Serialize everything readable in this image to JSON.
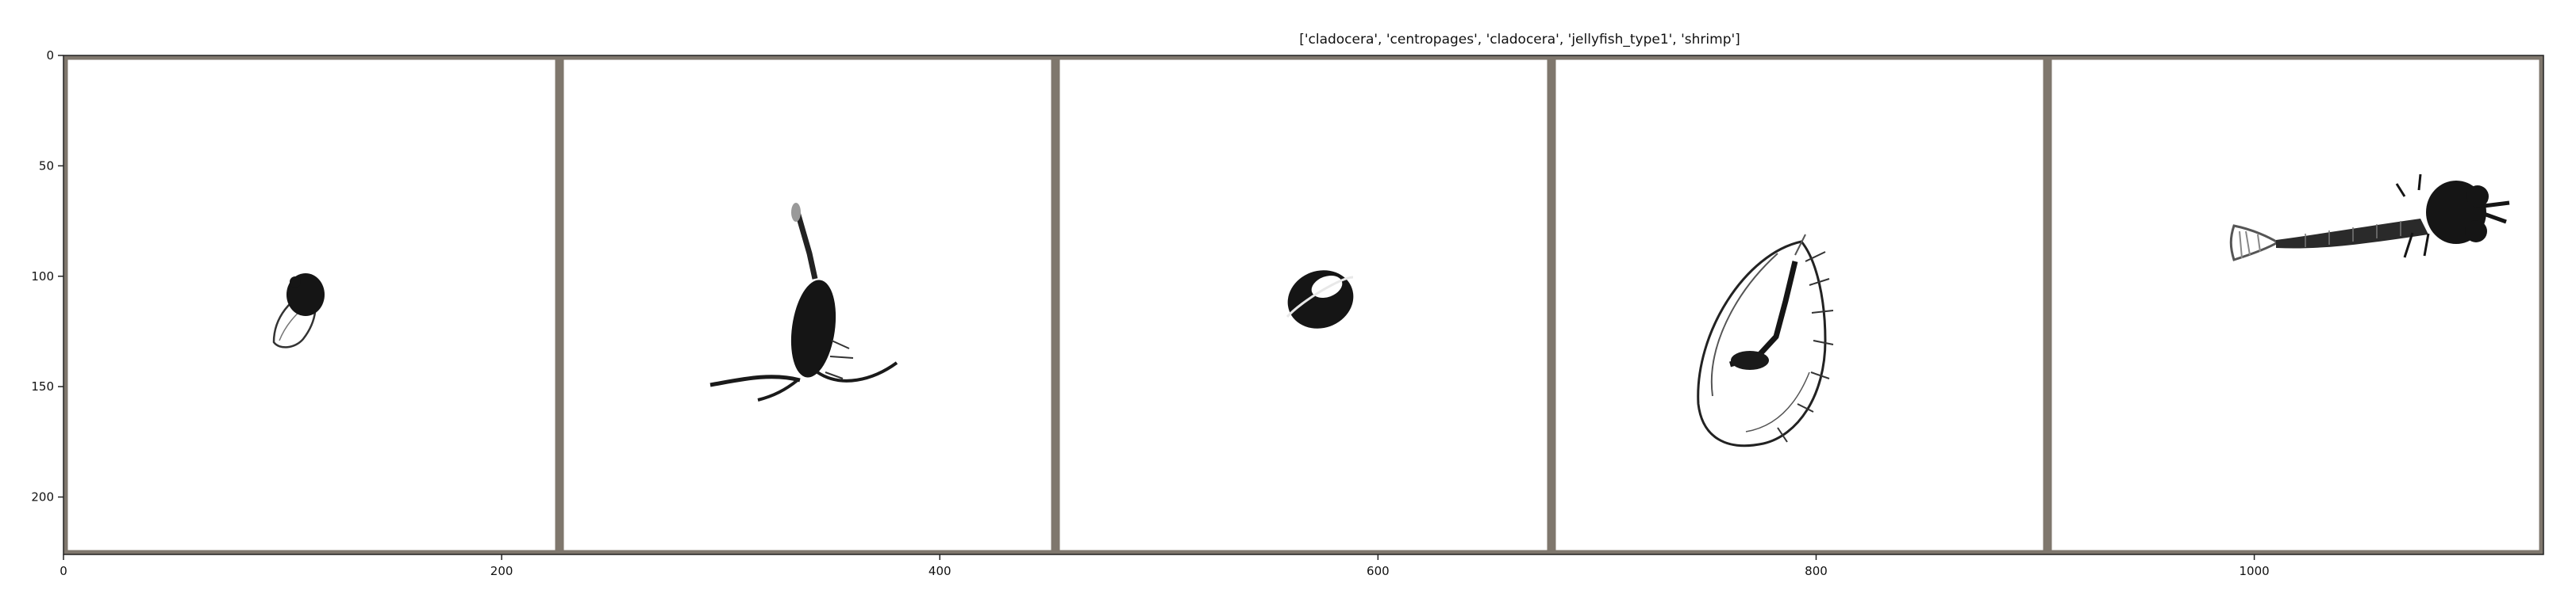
{
  "title": "['cladocera', 'centropages', 'cladocera', 'jellyfish_type1', 'shrimp']",
  "xaxis": {
    "ticks": [
      0,
      200,
      400,
      600,
      800,
      1000
    ],
    "range": [
      0,
      1132
    ]
  },
  "yaxis": {
    "ticks": [
      0,
      50,
      100,
      150,
      200
    ],
    "range": [
      0,
      226
    ],
    "inverted": true
  },
  "grid": false,
  "panels": [
    {
      "label": "cladocera"
    },
    {
      "label": "centropages"
    },
    {
      "label": "cladocera"
    },
    {
      "label": "jellyfish_type1"
    },
    {
      "label": "shrimp"
    }
  ],
  "colors": {
    "frame": "#7f776d",
    "background": "#ffffff",
    "specimen": "#151515"
  }
}
